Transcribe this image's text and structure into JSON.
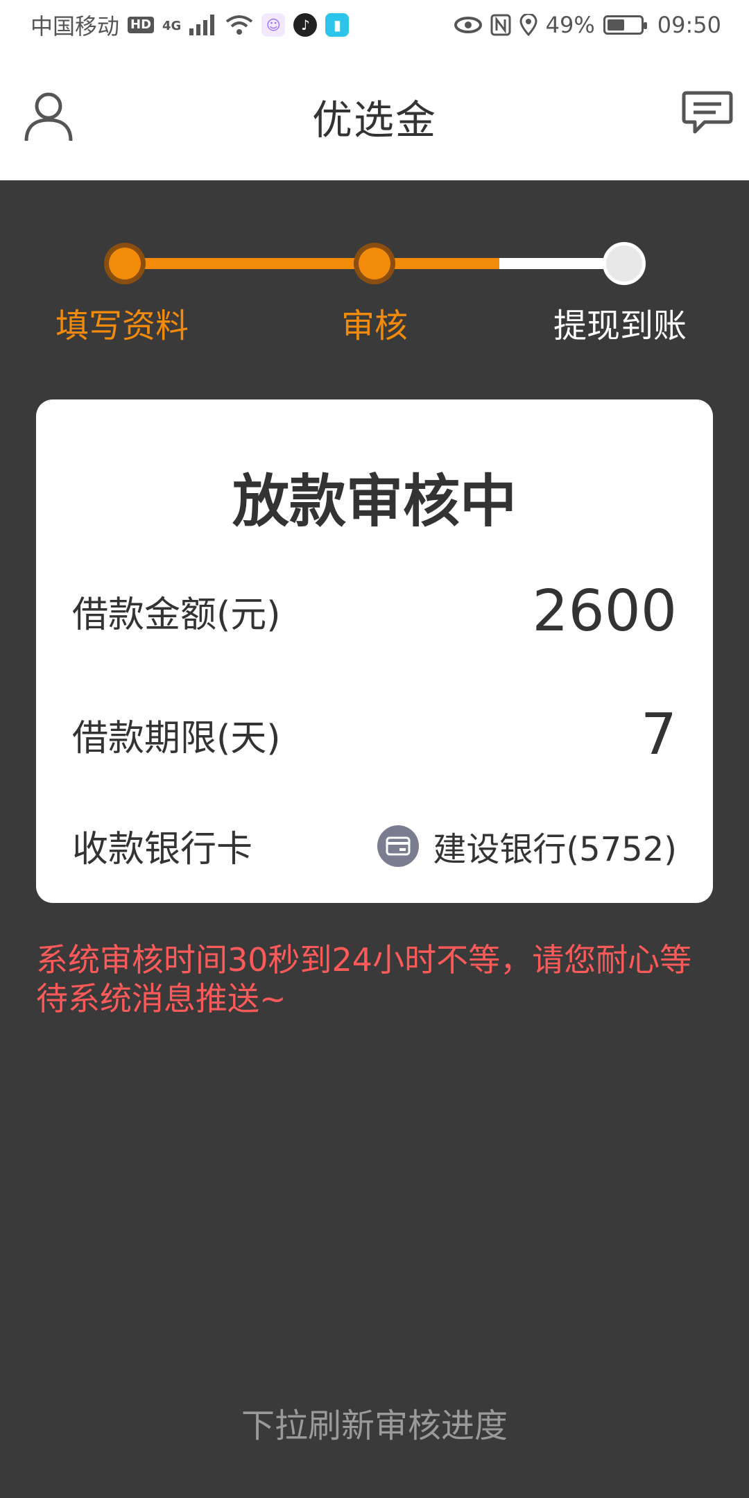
{
  "status_bar": {
    "carrier": "中国移动",
    "hd": "HD",
    "network": "4G",
    "battery": "49%",
    "time": "09:50"
  },
  "header": {
    "title": "优选金",
    "left_icon": "user-icon",
    "right_icon": "message-icon"
  },
  "steps": [
    {
      "label": "填写资料",
      "state": "done"
    },
    {
      "label": "审核",
      "state": "active"
    },
    {
      "label": "提现到账",
      "state": "pending"
    }
  ],
  "card": {
    "title": "放款审核中",
    "rows": [
      {
        "label": "借款金额(元)",
        "value": "2600"
      },
      {
        "label": "借款期限(天)",
        "value": "7"
      },
      {
        "label": "收款银行卡",
        "value": "建设银行(5752)"
      }
    ]
  },
  "notice": "系统审核时间30秒到24小时不等，请您耐心等待系统消息推送~",
  "pull_hint": "下拉刷新审核进度",
  "colors": {
    "accent": "#f28a0a",
    "background": "#3a3a3a",
    "notice": "#ff5a5a"
  }
}
